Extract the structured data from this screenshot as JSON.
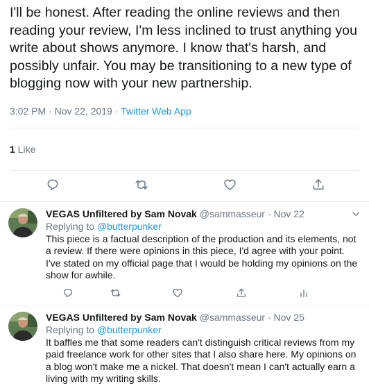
{
  "main_tweet": {
    "text": "I'll be honest. After reading the online reviews and then reading your review, I'm less inclined to trust anything you write about shows anymore. I know that's harsh, and possibly unfair. You may be transitioning to a new type of blogging now with your new partnership.",
    "time": "3:02 PM · Nov 22, 2019 · ",
    "app": "Twitter Web App",
    "like_count": "1",
    "like_label": " Like"
  },
  "replies": [
    {
      "name": "VEGAS Unfiltered by Sam Novak",
      "handle": "@sammasseur",
      "separator": " · ",
      "date": "Nov 22",
      "replying_prefix": "Replying to ",
      "replying_to": "@butterpunker",
      "text": "This piece is a factual description of the production and its elements, not a review. If there were opinions in this piece, I'd agree with your point. I've stated on my official page that I would be holding my opinions on the show for awhile."
    },
    {
      "name": "VEGAS Unfiltered by Sam Novak",
      "handle": "@sammasseur",
      "separator": " · ",
      "date": "Nov 25",
      "replying_prefix": "Replying to ",
      "replying_to": "@butterpunker",
      "text": "It baffles me that some readers can't distinguish critical reviews from my paid freelance work for other sites that I also share here. My opinions on a blog won't make me a nickel. That doesn't mean I can't actually earn a living with my writing skills."
    }
  ],
  "colors": {
    "text": "#14171a",
    "secondary": "#657786",
    "link": "#1b95e0",
    "divider": "#e6ecf0"
  },
  "icons": {
    "reply": "reply-icon",
    "retweet": "retweet-icon",
    "like": "heart-icon",
    "share": "share-icon",
    "analytics": "analytics-icon",
    "more": "chevron-down-icon"
  }
}
